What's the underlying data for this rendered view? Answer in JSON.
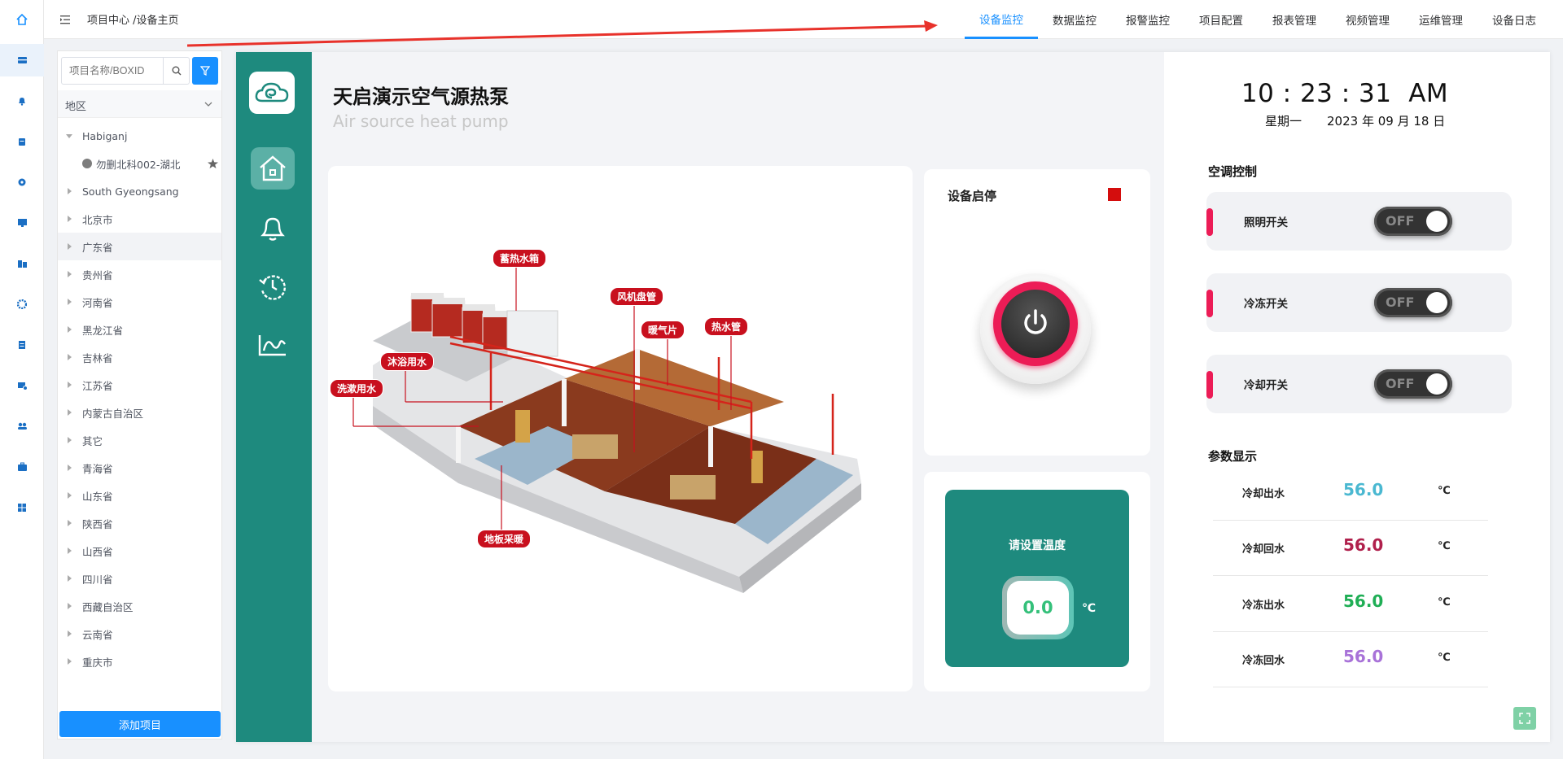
{
  "rail": {
    "icons": [
      "home-icon",
      "monitor-icon",
      "bell-icon",
      "database-icon",
      "settings-icon",
      "screen-icon",
      "building-icon",
      "gear-icon",
      "report-icon",
      "device-settings-icon",
      "users-icon",
      "briefcase-icon",
      "dashboard-icon"
    ]
  },
  "topbar": {
    "breadcrumb": "项目中心 /设备主页",
    "nav": [
      "设备监控",
      "数据监控",
      "报警监控",
      "项目配置",
      "报表管理",
      "视频管理",
      "运维管理",
      "设备日志"
    ],
    "active_nav": "设备监控"
  },
  "sidebar": {
    "search_placeholder": "项目名称/BOXID",
    "region_label": "地区",
    "tree": [
      {
        "label": "Habiganj",
        "expanded": true
      },
      {
        "label": "勿删北科002-湖北",
        "child": true
      },
      {
        "label": "South Gyeongsang"
      },
      {
        "label": "北京市"
      },
      {
        "label": "广东省"
      },
      {
        "label": "贵州省"
      },
      {
        "label": "河南省"
      },
      {
        "label": "黑龙江省"
      },
      {
        "label": "吉林省"
      },
      {
        "label": "江苏省"
      },
      {
        "label": "内蒙古自治区"
      },
      {
        "label": "其它"
      },
      {
        "label": "青海省"
      },
      {
        "label": "山东省"
      },
      {
        "label": "陕西省"
      },
      {
        "label": "山西省"
      },
      {
        "label": "四川省"
      },
      {
        "label": "西藏自治区"
      },
      {
        "label": "云南省"
      },
      {
        "label": "重庆市"
      }
    ],
    "add_button": "添加项目"
  },
  "device": {
    "title": "天启演示空气源热泵",
    "subtitle": "Air source heat pump",
    "diagram_labels": {
      "tank": "蓄热水箱",
      "fan_coil": "风机盘管",
      "radiator": "暖气片",
      "hot_pipe": "热水管",
      "bath": "沐浴用水",
      "wash": "洗漱用水",
      "floor": "地板采暖"
    },
    "power_title": "设备启停",
    "set_temp_title": "请设置温度",
    "set_temp_value": "0.0",
    "set_temp_unit": "℃"
  },
  "clock": {
    "time": "10 : 23 : 31  AM",
    "weekday": "星期一",
    "date": "2023 年 09 月 18 日"
  },
  "ac_control": {
    "title": "空调控制",
    "switches": [
      {
        "label": "照明开关",
        "state": "OFF"
      },
      {
        "label": "冷冻开关",
        "state": "OFF"
      },
      {
        "label": "冷却开关",
        "state": "OFF"
      }
    ]
  },
  "params": {
    "title": "参数显示",
    "rows": [
      {
        "label": "冷却出水",
        "value": "56.0",
        "unit": "℃",
        "color": "#4ab8d1"
      },
      {
        "label": "冷却回水",
        "value": "56.0",
        "unit": "℃",
        "color": "#b0204c"
      },
      {
        "label": "冷冻出水",
        "value": "56.0",
        "unit": "℃",
        "color": "#1fae55"
      },
      {
        "label": "冷冻回水",
        "value": "56.0",
        "unit": "℃",
        "color": "#a872d8"
      }
    ]
  },
  "colors": {
    "accent": "#1890ff",
    "teal": "#1e8a7e",
    "alarm": "#c8101e",
    "switch_bar": "#ec1c56"
  }
}
